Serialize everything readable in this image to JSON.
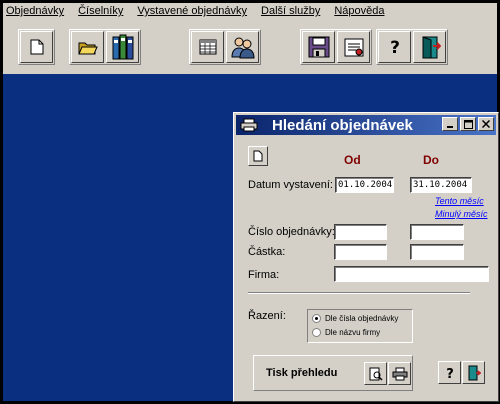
{
  "menu": [
    "Objednávky",
    "Číselníky",
    "Vystavené objednávky",
    "Další služby",
    "Nápověda"
  ],
  "toolbar": {
    "groups": [
      [
        "new-document-icon"
      ],
      [
        "open-folder-icon",
        "binders-icon"
      ],
      [
        "grid-table-icon",
        "people-icon"
      ],
      [
        "save-disk-icon",
        "certificate-icon"
      ],
      [
        "help-icon",
        "exit-door-icon"
      ]
    ]
  },
  "dialog": {
    "title": "Hledání objednávek",
    "col_from": "Od",
    "col_to": "Do",
    "date_label": "Datum vystavení:",
    "date_from": "01.10.2004",
    "date_to": "31.10.2004",
    "link_this_month": "Tento měsíc",
    "link_last_month": "Minulý měsíc",
    "order_no_label": "Číslo objednávky:",
    "amount_label": "Částka:",
    "company_label": "Firma:",
    "order_no_from": "",
    "order_no_to": "",
    "amount_from": "",
    "amount_to": "",
    "company": "",
    "sort_label": "Řazení:",
    "sort_options": [
      "Dle čísla objednávky",
      "Dle názvu firmy"
    ],
    "sort_selected": 0,
    "print_label": "Tisk přehledu",
    "colors": {
      "title_start": "#0a246a",
      "title_end": "#4a74c8",
      "header": "#800000",
      "link": "#0000ff"
    }
  }
}
